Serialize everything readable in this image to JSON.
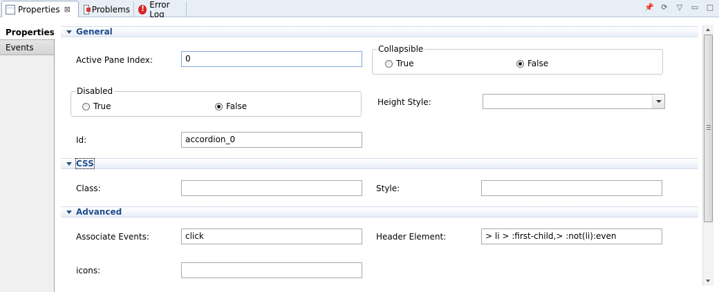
{
  "tabs": [
    {
      "label": "Properties",
      "icon": "properties-icon",
      "close": "⊠",
      "active": true
    },
    {
      "label": "Problems",
      "icon": "problems-icon",
      "active": false
    },
    {
      "label": "Error Log",
      "icon": "error-log-icon",
      "active": false
    }
  ],
  "view_toolbar": [
    "pin-icon",
    "sync-icon",
    "view-menu-icon",
    "minimize-icon",
    "maximize-icon"
  ],
  "left_tabs": [
    {
      "label": "Properties",
      "active": true
    },
    {
      "label": "Events",
      "active": false
    }
  ],
  "general": {
    "title": "General",
    "active_pane_index": {
      "label": "Active Pane Index:",
      "value": "0"
    },
    "collapsible": {
      "title": "Collapsible",
      "true_label": "True",
      "false_label": "False",
      "selected": "False"
    },
    "disabled": {
      "title": "Disabled",
      "true_label": "True",
      "false_label": "False",
      "selected": "False"
    },
    "height_style": {
      "label": "Height Style:",
      "value": ""
    },
    "id": {
      "label": "Id:",
      "value": "accordion_0"
    }
  },
  "css": {
    "title": "CSS",
    "class": {
      "label": "Class:",
      "value": ""
    },
    "style": {
      "label": "Style:",
      "value": ""
    }
  },
  "advanced": {
    "title": "Advanced",
    "associate_events": {
      "label": "Associate Events:",
      "value": "click"
    },
    "header_element": {
      "label": "Header Element:",
      "value": "> li > :first-child,> :not(li):even"
    },
    "icons": {
      "label": "icons:",
      "value": ""
    }
  },
  "colors": {
    "section_title": "#1f4d8c",
    "tabbar_bg": "#e8eef6"
  }
}
